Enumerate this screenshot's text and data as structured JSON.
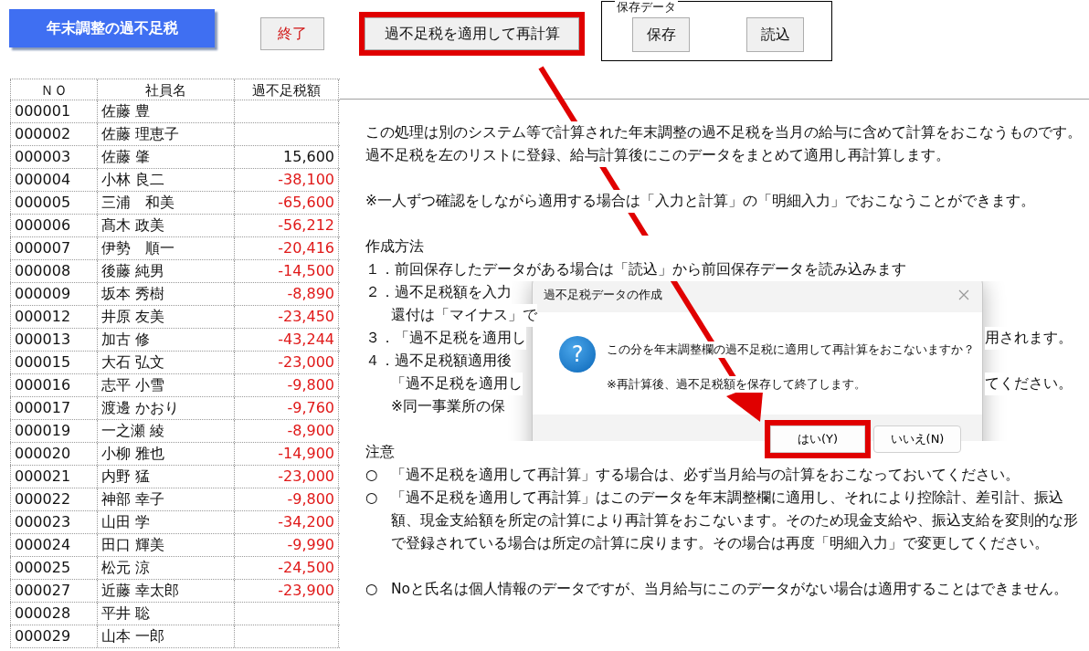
{
  "header": {
    "title": "年末調整の過不足税",
    "buttons": [
      {
        "label": "終了",
        "kind": "exit",
        "highlighted": false
      },
      {
        "label": "過不足税を適用して再計算",
        "kind": "normal",
        "highlighted": true
      }
    ],
    "save_group": {
      "title": "保存データ",
      "buttons": [
        "保存",
        "読込"
      ]
    }
  },
  "table": {
    "columns": [
      "ＮＯ",
      "社員名",
      "過不足税額"
    ],
    "rows": [
      {
        "no": "000001",
        "name": "佐藤 豊"
      },
      {
        "no": "000002",
        "name": "佐藤 理恵子"
      },
      {
        "no": "000003",
        "name": "佐藤 肇",
        "amount": "15,600",
        "negative": false
      },
      {
        "no": "000004",
        "name": "小林 良二",
        "amount": "-38,100",
        "negative": true
      },
      {
        "no": "000005",
        "name": "三浦　和美",
        "amount": "-65,600",
        "negative": true
      },
      {
        "no": "000006",
        "name": "髙木 政美",
        "amount": "-56,212",
        "negative": true
      },
      {
        "no": "000007",
        "name": "伊勢　順一",
        "amount": "-20,416",
        "negative": true
      },
      {
        "no": "000008",
        "name": "後藤 純男",
        "amount": "-14,500",
        "negative": true
      },
      {
        "no": "000009",
        "name": "坂本 秀樹",
        "amount": "-8,890",
        "negative": true
      },
      {
        "no": "000012",
        "name": "井原 友美",
        "amount": "-23,450",
        "negative": true
      },
      {
        "no": "000013",
        "name": "加古 修",
        "amount": "-43,244",
        "negative": true
      },
      {
        "no": "000015",
        "name": "大石 弘文",
        "amount": "-23,000",
        "negative": true
      },
      {
        "no": "000016",
        "name": "志平 小雪",
        "amount": "-9,800",
        "negative": true
      },
      {
        "no": "000017",
        "name": "渡邊 かおり",
        "amount": "-9,760",
        "negative": true
      },
      {
        "no": "000019",
        "name": "一之瀬 綾",
        "amount": "-8,900",
        "negative": true
      },
      {
        "no": "000020",
        "name": "小柳 雅也",
        "amount": "-14,900",
        "negative": true
      },
      {
        "no": "000021",
        "name": "内野 猛",
        "amount": "-23,000",
        "negative": true
      },
      {
        "no": "000022",
        "name": "神部 幸子",
        "amount": "-9,800",
        "negative": true
      },
      {
        "no": "000023",
        "name": "山田 学",
        "amount": "-34,200",
        "negative": true
      },
      {
        "no": "000024",
        "name": "田口 輝美",
        "amount": "-9,990",
        "negative": true
      },
      {
        "no": "000025",
        "name": "松元 涼",
        "amount": "-24,500",
        "negative": true
      },
      {
        "no": "000027",
        "name": "近藤 幸太郎",
        "amount": "-23,900",
        "negative": true
      },
      {
        "no": "000028",
        "name": "平井 聡"
      },
      {
        "no": "000029",
        "name": "山本 一郎"
      }
    ]
  },
  "notes": [
    {
      "lines": [
        {
          "kind": "text",
          "text": "この処理は別のシステム等で計算された年末調整の過不足税を当月の給与に含めて計算をおこなうものです。"
        },
        {
          "kind": "text",
          "text": "過不足税を左のリストに登録、給与計算後にこのデータをまとめて適用し再計算します。"
        }
      ]
    },
    {
      "lines": [
        {
          "kind": "text",
          "text": "※一人ずつ確認をしながら適用する場合は「入力と計算」の「明細入力」でおこなうことができます。"
        }
      ]
    },
    {
      "lines": [
        {
          "kind": "text",
          "text": "作成方法"
        },
        {
          "kind": "text",
          "text": "１．前回保存したデータがある場合は「読込」から前回保存データを読み込みます"
        },
        {
          "kind": "split",
          "left": "２．過不足税額を入力",
          "indented": false
        },
        {
          "kind": "split",
          "left": "還付は「マイナス」で",
          "indented": true
        },
        {
          "kind": "split",
          "left": "３．「過不足税を適用し",
          "right": "用されます。",
          "indented": false
        },
        {
          "kind": "split",
          "left": "４．過不足税額適用後",
          "indented": false
        },
        {
          "kind": "split",
          "left": "「過不足税を適用し",
          "right": "てください。",
          "indented": true
        },
        {
          "kind": "split",
          "left": "※同一事業所の保",
          "indented": true
        }
      ]
    },
    {
      "lines": [
        {
          "kind": "text",
          "text": "注意"
        },
        {
          "kind": "bullet",
          "mark": "○",
          "text": "「過不足税を適用して再計算」する場合は、必ず当月給与の計算をおこなっておいてください。"
        },
        {
          "kind": "bullet",
          "mark": "○",
          "text": "「過不足税を適用して再計算」はこのデータを年末調整欄に適用し、それにより控除計、差引計、振込額、現金支給額を所定の計算により再計算をおこないます。そのため現金支給や、振込支給を変則的な形で登録されている場合は所定の計算に戻ります。その場合は再度「明細入力」で変更してください。"
        }
      ]
    },
    {
      "lines": [
        {
          "kind": "bullet",
          "mark": "○",
          "text": "Noと氏名は個人情報のデータですが、当月給与にこのデータがない場合は適用することはできません。"
        }
      ]
    }
  ],
  "dialog": {
    "title": "過不足税データの作成",
    "icon_glyph": "?",
    "message": "この分を年末調整欄の過不足税に適用して再計算をおこないますか？",
    "note": "※再計算後、過不足税額を保存して終了します。",
    "buttons": [
      {
        "label": "はい(Y)",
        "highlighted": true
      },
      {
        "label": "いいえ(N)",
        "highlighted": false
      }
    ]
  }
}
